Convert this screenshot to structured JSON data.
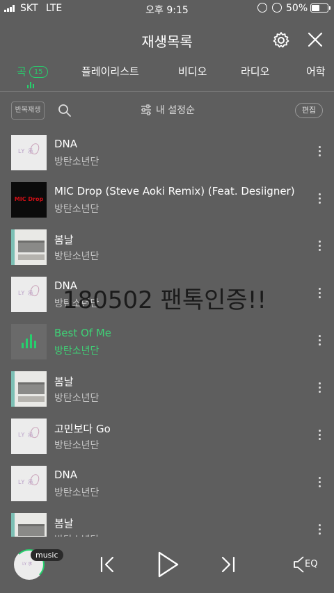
{
  "status": {
    "carrier": "SKT",
    "network": "LTE",
    "time": "오후 9:15",
    "battery_pct": "50%",
    "battery_level": 0.5
  },
  "header": {
    "title": "재생목록",
    "settings_icon": "gear-icon",
    "close_icon": "close-icon"
  },
  "tabs": {
    "items": [
      {
        "label": "곡",
        "badge": "15",
        "active": true
      },
      {
        "label": "플레이리스트"
      },
      {
        "label": "비디오"
      },
      {
        "label": "라디오"
      },
      {
        "label": "어학"
      }
    ]
  },
  "toolbar": {
    "repeat_label": "반복재생",
    "search_icon": "search-icon",
    "sort_label": "내 설정순",
    "edit_label": "편집"
  },
  "tracks": [
    {
      "title": "DNA",
      "artist": "방탄소년단",
      "art": "dna"
    },
    {
      "title": "MIC Drop (Steve Aoki Remix) (Feat. Desiigner)",
      "artist": "방탄소년단",
      "art": "mic"
    },
    {
      "title": "봄날",
      "artist": "방탄소년단",
      "art": "spring"
    },
    {
      "title": "DNA",
      "artist": "방탄소년단",
      "art": "dna"
    },
    {
      "title": "Best Of Me",
      "artist": "방탄소년단",
      "art": "playing",
      "active": true
    },
    {
      "title": "봄날",
      "artist": "방탄소년단",
      "art": "spring"
    },
    {
      "title": "고민보다 Go",
      "artist": "방탄소년단",
      "art": "dna"
    },
    {
      "title": "DNA",
      "artist": "방탄소년단",
      "art": "dna"
    },
    {
      "title": "봄날",
      "artist": "방탄소년단",
      "art": "spring"
    }
  ],
  "album_art_text": {
    "dna": "LY 承",
    "mic": "MIC Drop"
  },
  "overlay": {
    "text": "180502 팬톡인증!!"
  },
  "player": {
    "music_label": "music",
    "eq_label": "EQ"
  },
  "colors": {
    "accent": "#26d06d",
    "background": "#5e5e5e"
  }
}
